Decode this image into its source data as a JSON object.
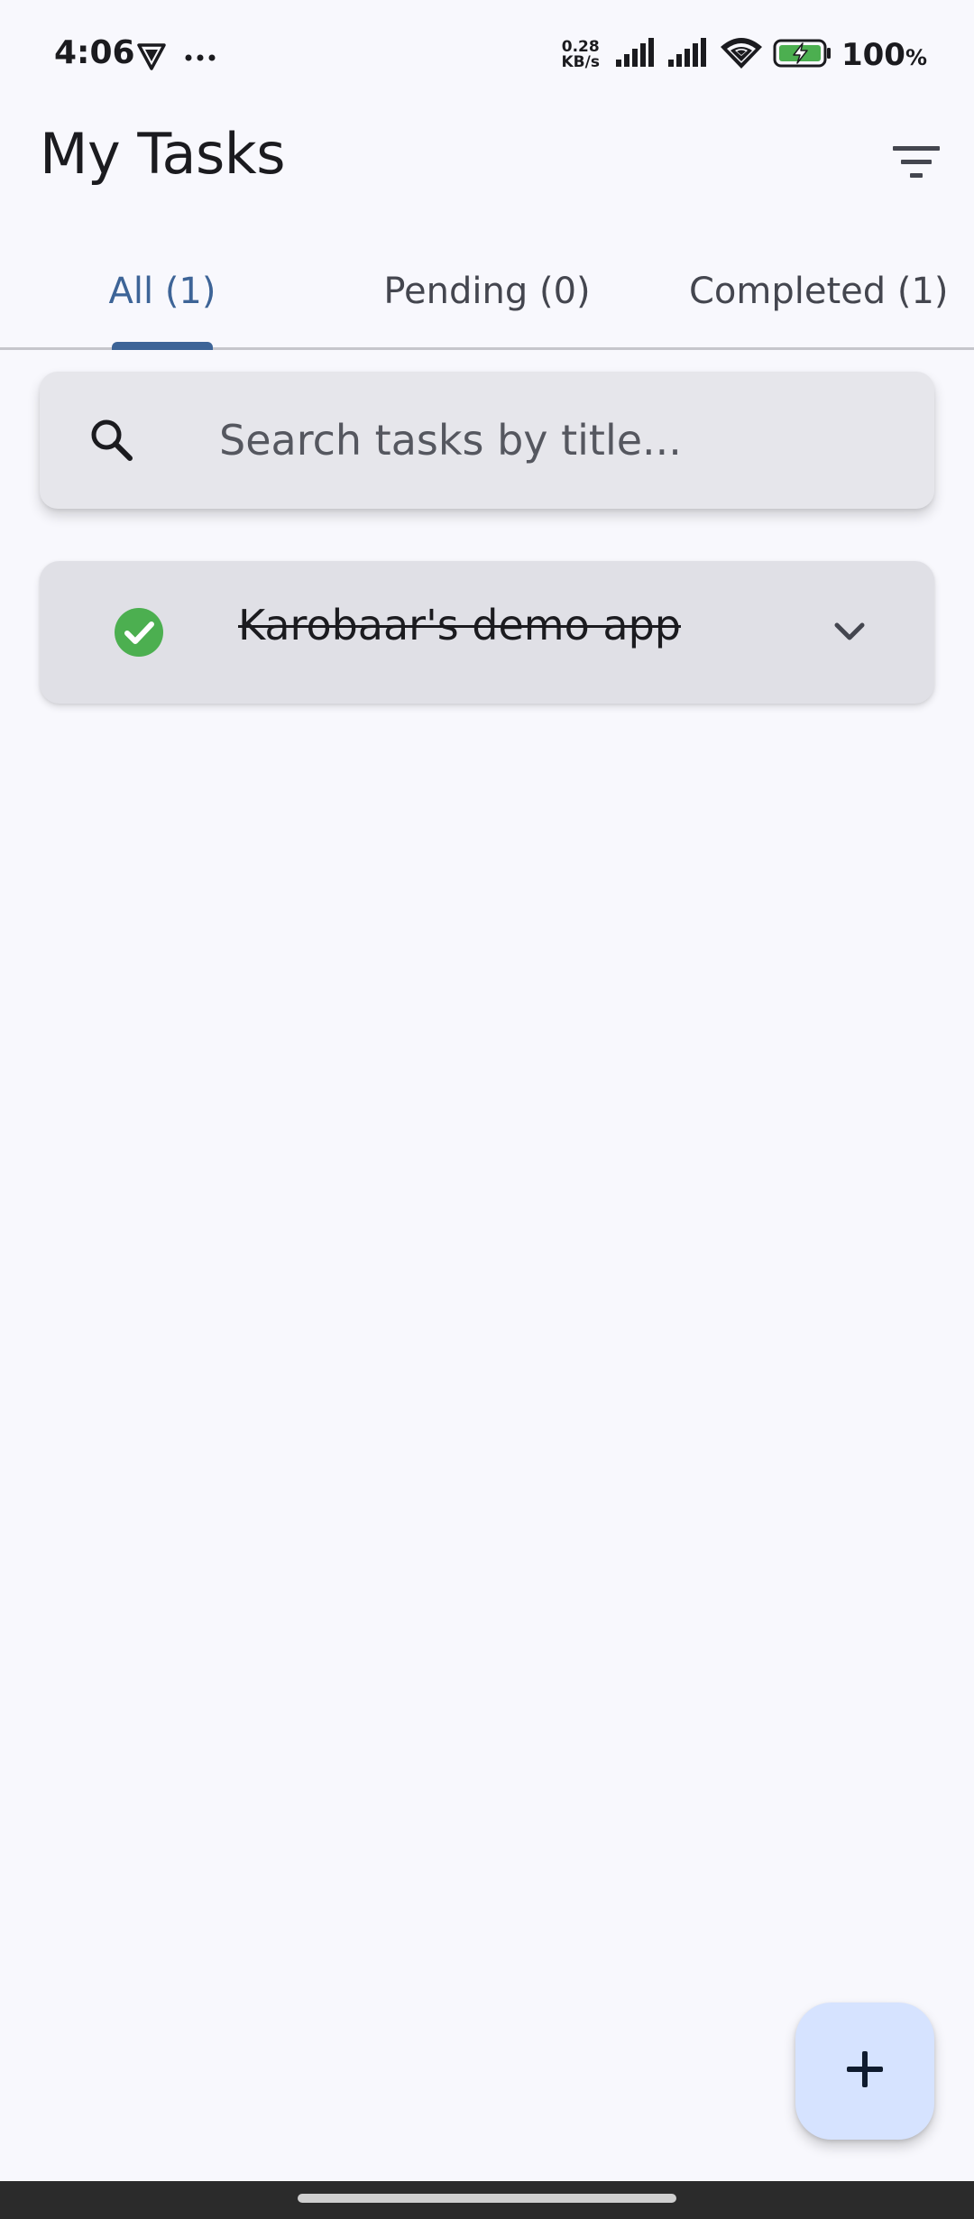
{
  "status_bar": {
    "time": "4:06",
    "net_speed_value": "0.28",
    "net_speed_unit": "KB/s",
    "battery": "100",
    "battery_unit": "%",
    "icons": [
      "vpn-shield-icon",
      "more-dots-icon",
      "signal-icon",
      "signal-icon",
      "wifi-icon",
      "battery-charging-icon"
    ]
  },
  "app_bar": {
    "title": "My Tasks",
    "filter_icon": "filter-icon"
  },
  "tabs": [
    {
      "label": "All (1)",
      "active": true
    },
    {
      "label": "Pending (0)",
      "active": false
    },
    {
      "label": "Completed (1)",
      "active": false
    }
  ],
  "search": {
    "placeholder": "Search tasks by title...",
    "value": "",
    "icon": "search-icon"
  },
  "tasks": [
    {
      "title": "Karobaar's demo app",
      "completed": true,
      "status_icon": "check-circle-icon",
      "expand_icon": "chevron-down-icon"
    }
  ],
  "fab": {
    "icon": "plus-icon"
  },
  "colors": {
    "accent": "#3d6497",
    "completed_green": "#4caf50",
    "background": "#f8f8fd",
    "fab_background": "#d6e3ff"
  }
}
